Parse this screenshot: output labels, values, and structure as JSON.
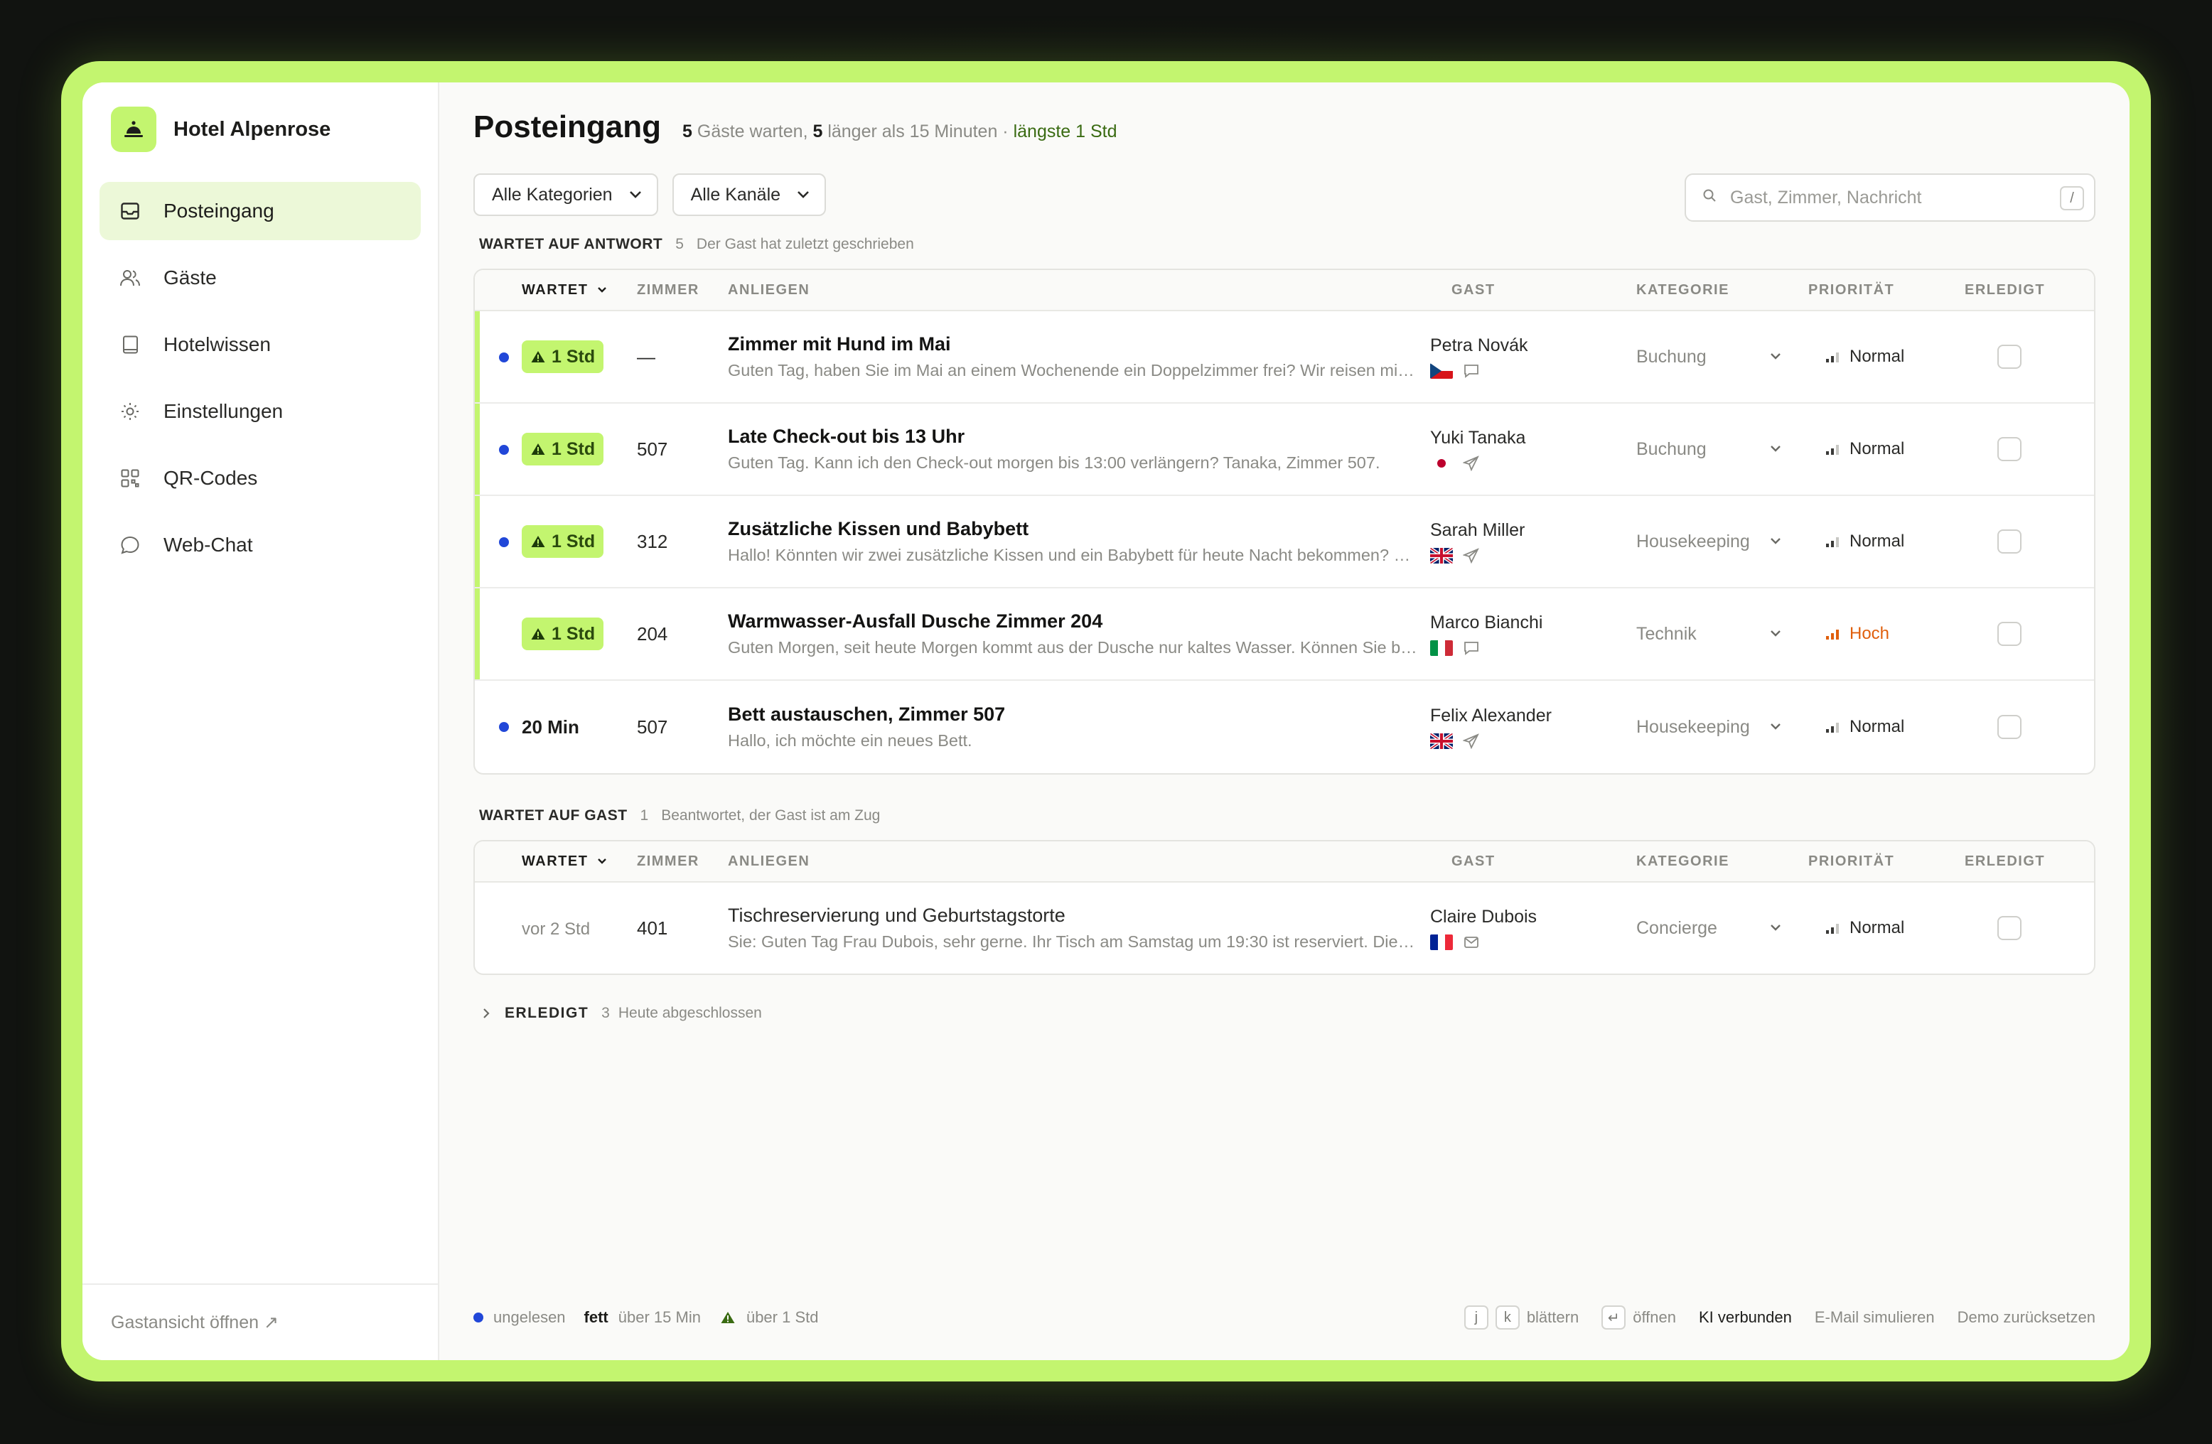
{
  "app": {
    "hotel_name": "Hotel Alpenrose",
    "accent_color": "#c3f56f",
    "unread_color": "#2147d8"
  },
  "sidebar": {
    "items": [
      {
        "label": "Posteingang",
        "icon": "inbox-icon",
        "active": true
      },
      {
        "label": "Gäste",
        "icon": "users-icon"
      },
      {
        "label": "Hotelwissen",
        "icon": "book-icon"
      },
      {
        "label": "Einstellungen",
        "icon": "sun-gear-icon"
      },
      {
        "label": "QR-Codes",
        "icon": "qr-grid-icon"
      },
      {
        "label": "Web-Chat",
        "icon": "chat-bubble-icon"
      }
    ],
    "footer_link": "Gastansicht öffnen ↗"
  },
  "header": {
    "title": "Posteingang",
    "waiting_count": "5",
    "waiting_text": " Gäste warten, ",
    "long_count": "5",
    "long_text": " länger als 15 Minuten · ",
    "longest_text": "längste 1 Std"
  },
  "filters": {
    "category": "Alle Kategorien",
    "channel": "Alle Kanäle",
    "search_placeholder": "Gast, Zimmer, Nachricht",
    "search_shortcut": "/"
  },
  "columns": {
    "wait": "WARTET",
    "room": "ZIMMER",
    "request": "ANLIEGEN",
    "guest": "GAST",
    "category": "KATEGORIE",
    "priority": "PRIORITÄT",
    "done": "ERLEDIGT"
  },
  "section_awaiting_reply": {
    "name": "WARTET AUF ANTWORT",
    "count": "5",
    "desc": "Der Gast hat zuletzt geschrieben",
    "rows": [
      {
        "wait": "1 Std",
        "room": "—",
        "title": "Zimmer mit Hund im Mai",
        "preview": "Guten Tag, haben Sie im Mai an einem Wochenende ein Doppelzimmer frei? Wir reisen mit unserem Hund und möchten wissen, ob das möglich ist.",
        "guest": "Petra Novák",
        "flag": "cz",
        "channel": "chat",
        "category": "Buchung",
        "priority": "Normal"
      },
      {
        "wait": "1 Std",
        "room": "507",
        "title": "Late Check-out bis 13 Uhr",
        "preview": "Guten Tag. Kann ich den Check-out morgen bis 13:00 verlängern? Tanaka, Zimmer 507.",
        "guest": "Yuki Tanaka",
        "flag": "jp",
        "channel": "send",
        "category": "Buchung",
        "priority": "Normal"
      },
      {
        "wait": "1 Std",
        "room": "312",
        "title": "Zusätzliche Kissen und Babybett",
        "preview": "Hallo! Könnten wir zwei zusätzliche Kissen und ein Babybett für heute Nacht bekommen? Vielen Dank im Voraus.",
        "guest": "Sarah Miller",
        "flag": "gb",
        "channel": "send",
        "category": "Housekeeping",
        "priority": "Normal"
      },
      {
        "wait": "1 Std",
        "room": "204",
        "title": "Warmwasser-Ausfall Dusche Zimmer 204",
        "preview": "Guten Morgen, seit heute Morgen kommt aus der Dusche nur kaltes Wasser. Können Sie bitte jemanden schicken?",
        "guest": "Marco Bianchi",
        "flag": "it",
        "channel": "chat",
        "category": "Technik",
        "priority": "Hoch"
      },
      {
        "wait": "20 Min",
        "room": "507",
        "title": "Bett austauschen, Zimmer 507",
        "preview": "Hallo, ich möchte ein neues Bett.",
        "guest": "Felix Alexander",
        "flag": "gb",
        "channel": "send",
        "category": "Housekeeping",
        "priority": "Normal"
      }
    ]
  },
  "section_awaiting_guest": {
    "name": "WARTET AUF GAST",
    "count": "1",
    "desc": "Beantwortet, der Gast ist am Zug",
    "rows": [
      {
        "wait": "vor 2 Std",
        "room": "401",
        "title": "Tischreservierung und Geburtstagstorte",
        "preview": "Sie: Guten Tag Frau Dubois, sehr gerne. Ihr Tisch am Samstag um 19:30 ist reserviert. Die Torte bereiten wir gerne vor.",
        "guest": "Claire Dubois",
        "flag": "fr",
        "channel": "mail",
        "category": "Concierge",
        "priority": "Normal"
      }
    ]
  },
  "section_done": {
    "name": "ERLEDIGT",
    "count": "3",
    "desc": "Heute abgeschlossen"
  },
  "footer": {
    "legend_unread": "ungelesen",
    "legend_bold": "fett",
    "legend_bold_desc": "über 15 Min",
    "legend_warn": "über 1 Std",
    "key_j": "j",
    "key_k": "k",
    "scroll": "blättern",
    "key_enter": "↵",
    "open": "öffnen",
    "ai": "KI verbunden",
    "simulate": "E-Mail simulieren",
    "reset": "Demo zurücksetzen"
  }
}
